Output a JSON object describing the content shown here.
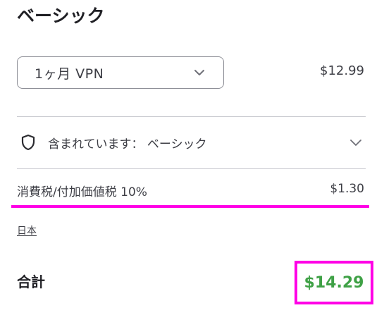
{
  "plan": {
    "title": "ベーシック",
    "selected_option": "1ヶ月 VPN",
    "price": "$12.99"
  },
  "included": {
    "text": "含まれています： ベーシック",
    "icon": "shield-icon"
  },
  "tax": {
    "label": "消費税/付加価値税 10%",
    "amount": "$1.30"
  },
  "language_link": "日本",
  "total": {
    "label": "合計",
    "amount": "$14.29"
  },
  "colors": {
    "highlight": "#ff00e6",
    "total_amount": "#3fa146",
    "divider": "#c9cad0"
  }
}
